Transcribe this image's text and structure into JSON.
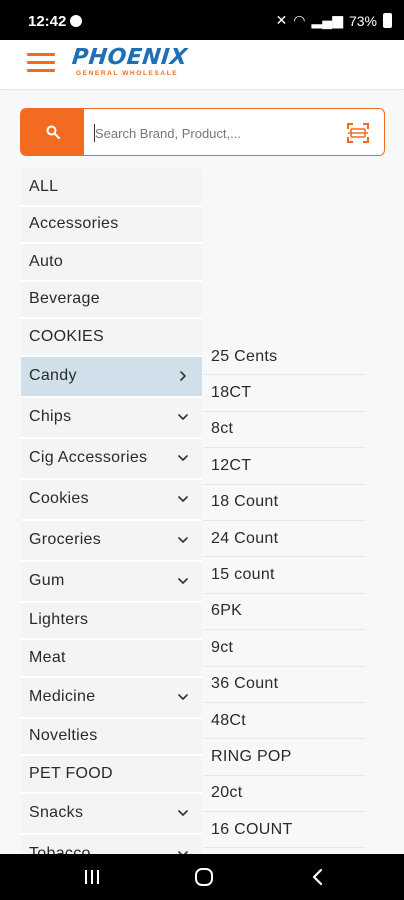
{
  "status_bar": {
    "time": "12:42",
    "battery": "73%"
  },
  "app_bar": {
    "logo_text": "PHOENIX",
    "logo_tagline": "GENERAL WHOLESALE"
  },
  "search": {
    "placeholder": "Search Brand, Product,..."
  },
  "categories": [
    {
      "label": "ALL",
      "expandable": false
    },
    {
      "label": "Accessories",
      "expandable": false
    },
    {
      "label": "Auto",
      "expandable": false
    },
    {
      "label": "Beverage",
      "expandable": false
    },
    {
      "label": "COOKIES",
      "expandable": false
    },
    {
      "label": "Candy",
      "expandable": true,
      "active": true
    },
    {
      "label": "Chips",
      "expandable": true
    },
    {
      "label": "Cig Accessories",
      "expandable": true
    },
    {
      "label": "Cookies",
      "expandable": true
    },
    {
      "label": "Groceries",
      "expandable": true
    },
    {
      "label": "Gum",
      "expandable": true
    },
    {
      "label": "Lighters",
      "expandable": false
    },
    {
      "label": "Meat",
      "expandable": false
    },
    {
      "label": "Medicine",
      "expandable": true
    },
    {
      "label": "Novelties",
      "expandable": false
    },
    {
      "label": "PET FOOD",
      "expandable": false
    },
    {
      "label": "Snacks",
      "expandable": true
    },
    {
      "label": "Tobacco",
      "expandable": true
    }
  ],
  "subcategories": [
    "25 Cents",
    "18CT",
    "8ct",
    "12CT",
    "18 Count",
    "24 Count",
    "15 count",
    "6PK",
    "9ct",
    "36 Count",
    "48Ct",
    "RING POP",
    "20ct",
    "16 COUNT"
  ],
  "colors": {
    "accent": "#f26b21",
    "brand_blue": "#1f6fb5",
    "active_category": "#cfe0ea"
  }
}
